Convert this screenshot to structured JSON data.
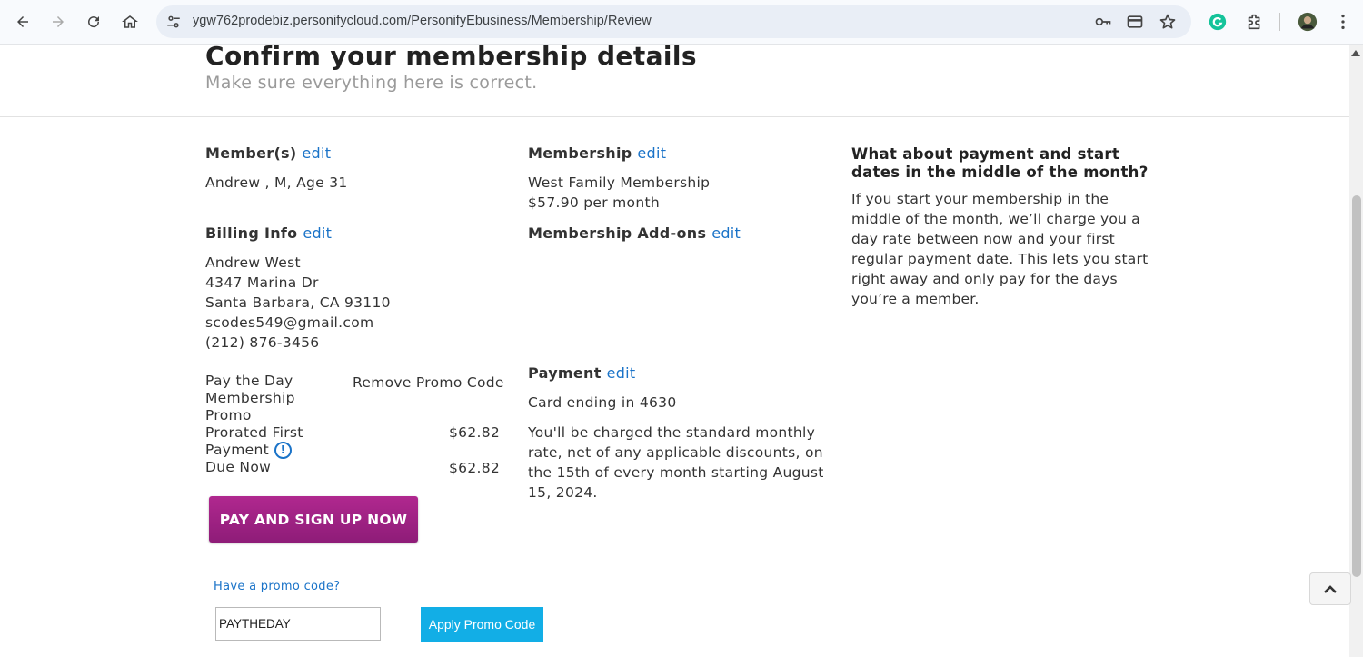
{
  "browser": {
    "url": "ygw762prodebiz.personifycloud.com/PersonifyEbusiness/Membership/Review"
  },
  "header": {
    "title": "Confirm your membership details",
    "subtitle": "Make sure everything here is correct."
  },
  "members": {
    "heading": "Member(s)",
    "edit": "edit",
    "value": "Andrew , M, Age 31"
  },
  "billing": {
    "heading": "Billing Info",
    "edit": "edit",
    "name": "Andrew West",
    "street": "4347 Marina Dr",
    "city": "Santa Barbara, CA 93110",
    "email": "scodes549@gmail.com",
    "phone": "(212) 876-3456"
  },
  "summary": {
    "promo_line_1": "Pay the Day",
    "promo_line_2": "Membership",
    "promo_line_3": "Promo",
    "remove_promo": "Remove Promo Code",
    "prorated_line_1": "Prorated First",
    "prorated_line_2": "Payment",
    "prorated_amount": "$62.82",
    "due_label": "Due Now",
    "due_amount": "$62.82",
    "info_glyph": "!"
  },
  "pay_button": "PAY AND SIGN UP NOW",
  "promo": {
    "link": "Have a promo code?",
    "input_value": "PAYTHEDAY",
    "apply_button": "Apply Promo Code"
  },
  "membership": {
    "heading": "Membership",
    "edit": "edit",
    "name": "West Family Membership",
    "price": "$57.90 per month"
  },
  "addons": {
    "heading": "Membership Add-ons",
    "edit": "edit"
  },
  "payment": {
    "heading": "Payment",
    "edit": "edit",
    "card": "Card ending in 4630",
    "note_1": "You'll be charged the standard monthly",
    "note_2": "rate, net of any applicable discounts, on",
    "note_3": "the 15th of every month starting August",
    "note_4": "15, 2024."
  },
  "sidebar": {
    "heading": "What about payment and start dates in the middle of the month?",
    "body": "If you start your membership in the middle of the month, we’ll charge you a day rate between now and your first regular payment date. This lets you start right away and only pay for the days you’re a member."
  },
  "colors": {
    "link": "#1a73c8",
    "pay_button": "#9c2283",
    "apply_button": "#12aee6"
  }
}
